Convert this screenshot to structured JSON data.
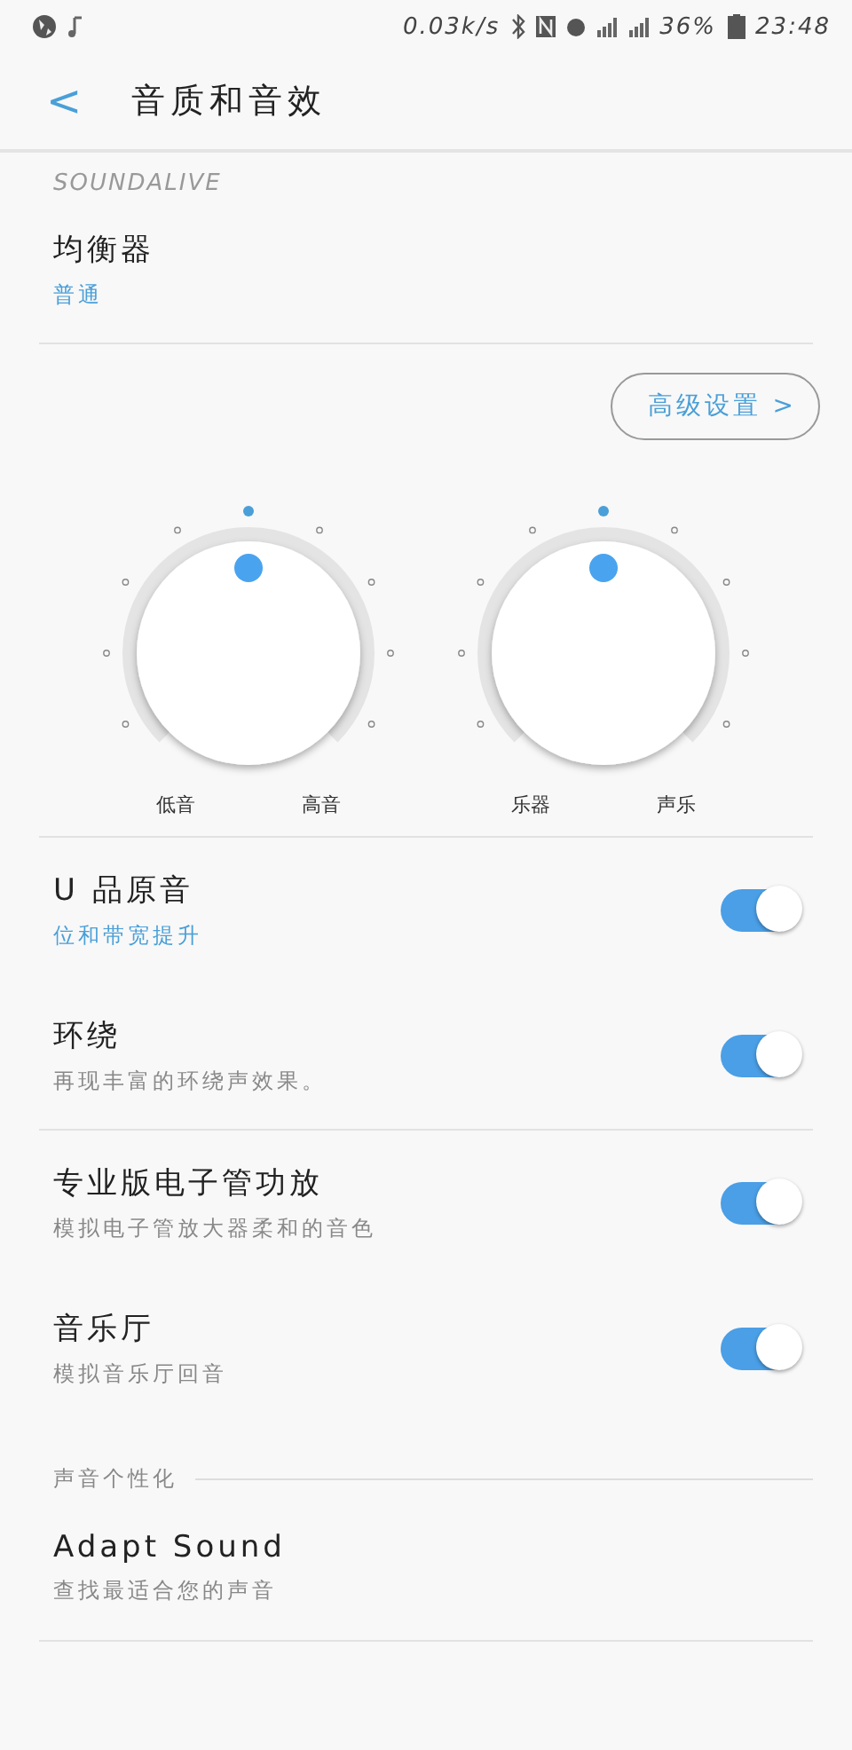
{
  "status_bar": {
    "speed": "0.03k/s",
    "battery": "36%",
    "time": "23:48"
  },
  "header": {
    "back": "<",
    "title": "音质和音效"
  },
  "section": "SOUNDALIVE",
  "equalizer": {
    "title": "均衡器",
    "value": "普通"
  },
  "advanced_button": "高级设置 >",
  "knobs": [
    {
      "left_label": "低音",
      "right_label": "高音"
    },
    {
      "left_label": "乐器",
      "right_label": "声乐"
    }
  ],
  "toggles": [
    {
      "title": "U 品原音",
      "subtitle": "位和带宽提升",
      "subtitle_accent": true,
      "on": true,
      "divider": false
    },
    {
      "title": "环绕",
      "subtitle": "再现丰富的环绕声效果。",
      "subtitle_accent": false,
      "on": true,
      "divider": true
    },
    {
      "title": "专业版电子管功放",
      "subtitle": "模拟电子管放大器柔和的音色",
      "subtitle_accent": false,
      "on": true,
      "divider": false
    },
    {
      "title": "音乐厅",
      "subtitle": "模拟音乐厅回音",
      "subtitle_accent": false,
      "on": true,
      "divider": false
    }
  ],
  "personalize": {
    "header": "声音个性化",
    "items": [
      {
        "title": "Adapt Sound",
        "subtitle": "查找最适合您的声音"
      }
    ]
  }
}
